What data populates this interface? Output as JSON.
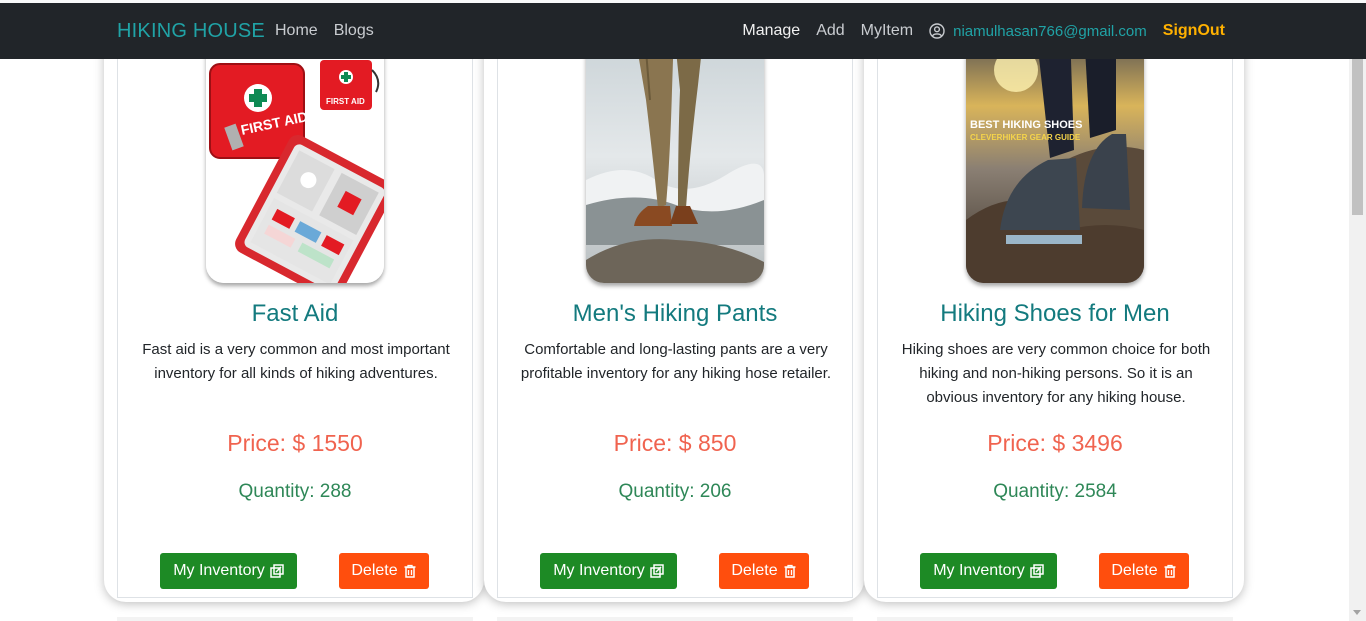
{
  "navbar": {
    "brand": "HIKING HOUSE",
    "links_left": [
      "Home",
      "Blogs"
    ],
    "links_right": [
      "Manage",
      "Add",
      "MyItem"
    ],
    "user_email": "niamulhasan766@gmail.com",
    "signout": "SignOut"
  },
  "colors": {
    "navbar_bg": "#212529",
    "brand": "#20a3a6",
    "title": "#137a7e",
    "price": "#f0634f",
    "quantity": "#2e8757",
    "inventory_button": "#1d8a25",
    "delete_button": "#ff4e0d",
    "signout": "#ffb100"
  },
  "cards": [
    {
      "title": "Fast Aid",
      "description": "Fast aid is a very common and most important inventory for all kinds of hiking adventures.",
      "price": "Price: $ 1550",
      "quantity": "Quantity: 288",
      "inventory_label": "My Inventory",
      "delete_label": "Delete",
      "image_icon": "first-aid-kit-image",
      "image_text": [
        "FIRST AID",
        "FIRST AID"
      ]
    },
    {
      "title": "Men's Hiking Pants",
      "description": "Comfortable and long-lasting pants are a very profitable inventory for any hiking hose retailer.",
      "price": "Price: $ 850",
      "quantity": "Quantity: 206",
      "inventory_label": "My Inventory",
      "delete_label": "Delete",
      "image_icon": "hiking-pants-image",
      "image_text": []
    },
    {
      "title": "Hiking Shoes for Men",
      "description": "Hiking shoes are very common choice for both hiking and non-hiking persons. So it is an obvious inventory for any hiking house.",
      "price": "Price: $ 3496",
      "quantity": "Quantity: 2584",
      "inventory_label": "My Inventory",
      "delete_label": "Delete",
      "image_icon": "hiking-shoes-image",
      "image_text": [
        "BEST HIKING SHOES",
        "CLEVERHIKER GEAR GUIDE"
      ]
    }
  ]
}
